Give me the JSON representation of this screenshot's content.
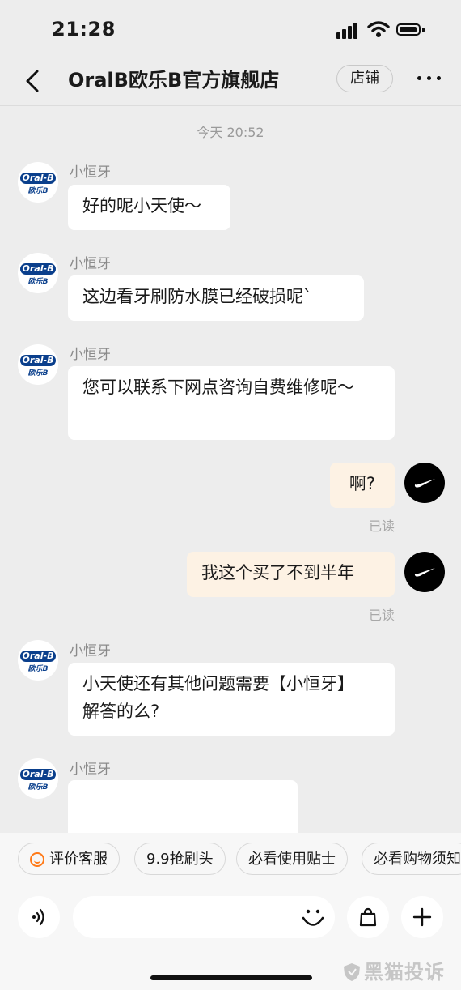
{
  "status_bar": {
    "time": "21:28"
  },
  "nav": {
    "title": "OralB欧乐B官方旗舰店",
    "shop_button": "店铺"
  },
  "chat": {
    "timestamp": "今天 20:52",
    "avatar_brand": {
      "logo": "Oral-B",
      "sub": "欧乐B"
    },
    "messages": [
      {
        "from": "shop",
        "sender": "小恒牙",
        "text": "好的呢小天使～"
      },
      {
        "from": "shop",
        "sender": "小恒牙",
        "text": "这边看牙刷防水膜已经破损呢`"
      },
      {
        "from": "shop",
        "sender": "小恒牙",
        "text": "您可以联系下网点咨询自费维修呢～"
      },
      {
        "from": "me",
        "text": "啊?",
        "status": "已读"
      },
      {
        "from": "me",
        "text": "我这个买了不到半年",
        "status": "已读"
      },
      {
        "from": "shop",
        "sender": "小恒牙",
        "text": "小天使还有其他问题需要【小恒牙】解答的么?"
      },
      {
        "from": "shop",
        "sender": "小恒牙",
        "text": ""
      }
    ]
  },
  "quick_replies": [
    "评价客服",
    "9.9抢刷头",
    "必看使用贴士",
    "必看购物须知"
  ],
  "input": {
    "placeholder": ""
  },
  "watermark": "黑猫投诉",
  "icons": {
    "back": "chevron-left-icon",
    "more": "more-dots-icon",
    "voice": "voice-icon",
    "emoji": "emoji-icon",
    "shop_bag": "shopping-bag-icon",
    "add": "plus-icon"
  },
  "colors": {
    "my_bubble": "#fdf2e4",
    "brand_blue": "#0a3f8c",
    "accent_orange": "#ff7a18"
  }
}
